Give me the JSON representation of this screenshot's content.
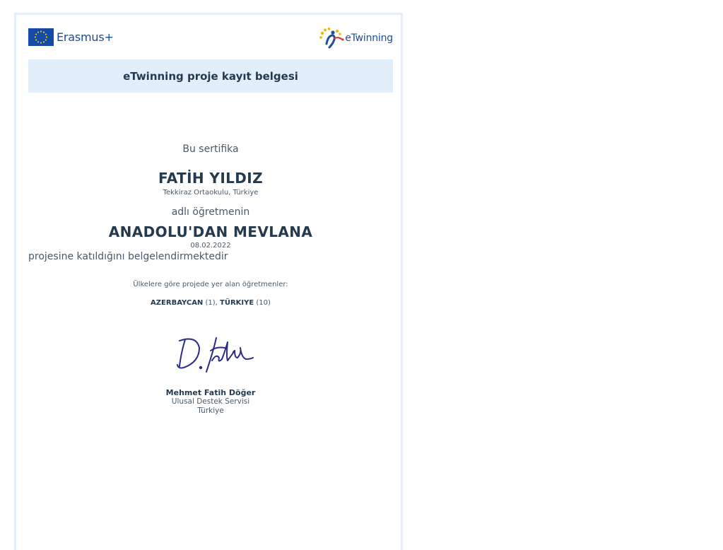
{
  "header": {
    "erasmus_label": "Erasmus+",
    "etwinning_label": "eTwinning"
  },
  "title": "eTwinning proje kayıt belgesi",
  "certificate": {
    "intro": "Bu sertifika",
    "teacher_name": "FATİH YILDIZ",
    "school": "Tekkiraz Ortaokulu, Türkiye",
    "adli": "adlı öğretmenin",
    "project_name": "ANADOLU'DAN MEVLANA",
    "date": "08.02.2022",
    "statement": "projesine katıldığını belgelendirmektedir",
    "countries_label": "Ülkelere göre projede yer alan öğretmenler:",
    "countries": [
      {
        "name": "AZERBAYCAN",
        "count": "(1)",
        "sep": ", "
      },
      {
        "name": "TÜRKIYE",
        "count": "(10)",
        "sep": ""
      }
    ]
  },
  "signatory": {
    "name": "Mehmet Fatih Döğer",
    "org": "Ulusal Destek Servisi",
    "country": "Türkiye"
  },
  "colors": {
    "border": "#e3eefb",
    "title_band": "#e3eefb",
    "eu_blue": "#154ba6",
    "eu_star": "#ffde00",
    "text_dark": "#253a4e",
    "signature_ink": "#2a2a8a"
  }
}
